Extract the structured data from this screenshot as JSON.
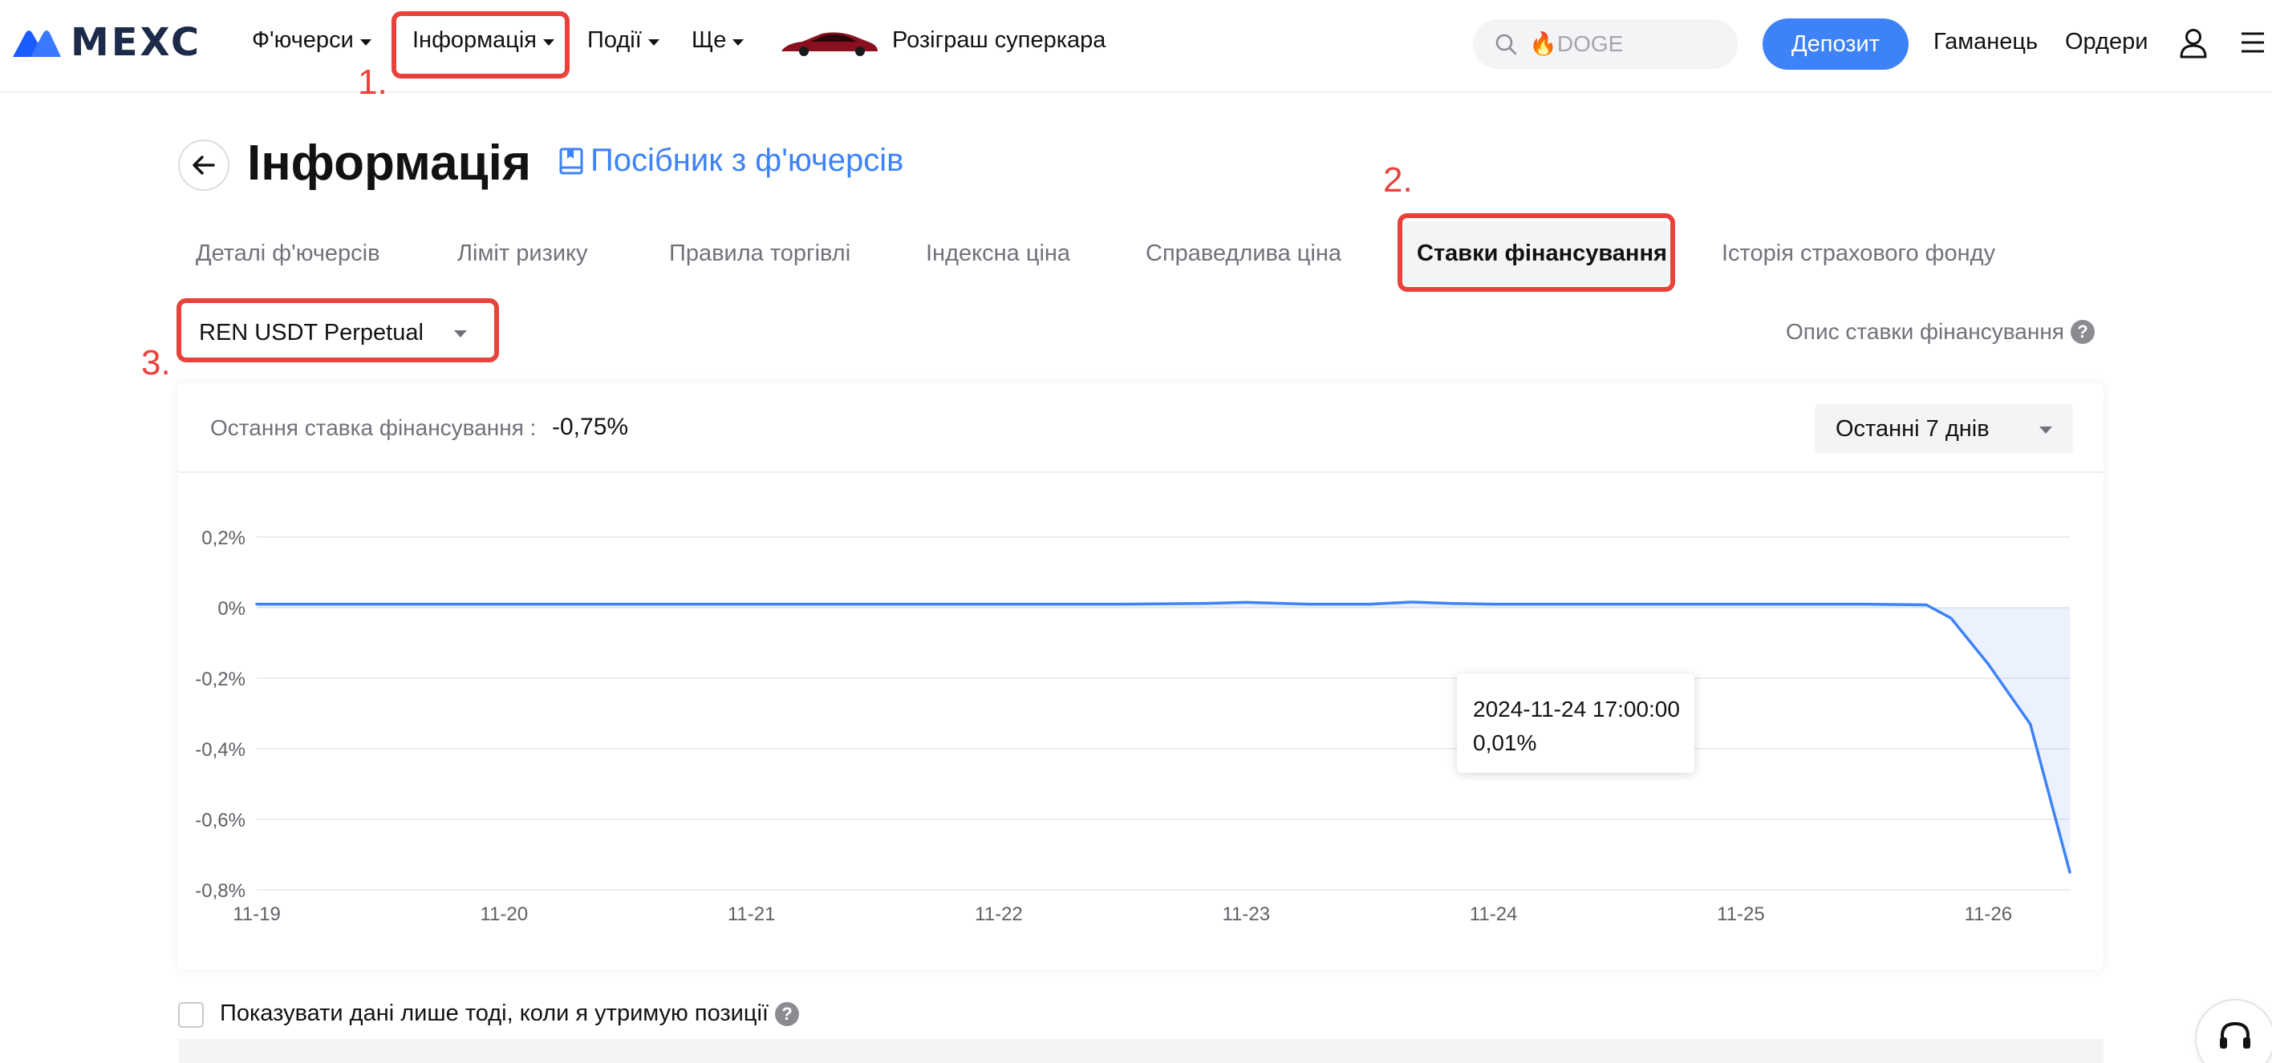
{
  "nav": {
    "logo_text": "MEXC",
    "items": [
      {
        "label": "Ф'ючерси"
      },
      {
        "label": "Інформація"
      },
      {
        "label": "Події"
      },
      {
        "label": "Ще"
      }
    ],
    "promo_label": "Розіграш суперкара",
    "search_placeholder": "🔥DOGE",
    "deposit_label": "Депозит",
    "wallet_label": "Гаманець",
    "orders_label": "Ордери"
  },
  "annotations": [
    "1.",
    "2.",
    "3."
  ],
  "page": {
    "title": "Інформація",
    "guide_link": "Посібник з ф'ючерсів"
  },
  "tabs": [
    {
      "label": "Деталі ф'ючерсів",
      "active": false
    },
    {
      "label": "Ліміт ризику",
      "active": false
    },
    {
      "label": "Правила торгівлі",
      "active": false
    },
    {
      "label": "Індексна ціна",
      "active": false
    },
    {
      "label": "Справедлива ціна",
      "active": false
    },
    {
      "label": "Ставки фінансування",
      "active": true
    },
    {
      "label": "Історія страхового фонду",
      "active": false
    }
  ],
  "contract_select": {
    "value": "REN USDT Perpetual"
  },
  "funding_description_label": "Опис ставки фінансування",
  "card": {
    "last_rate_label": "Остання ставка фінансування :",
    "last_rate_value": "-0,75%",
    "period_value": "Останні 7 днів"
  },
  "tooltip": {
    "time": "2024-11-24 17:00:00",
    "value": "0,01%"
  },
  "bottom": {
    "checkbox_label": "Показувати дані лише тоді, коли я утримую позиції"
  },
  "colors": {
    "accent": "#3e82f7",
    "annotation": "#e8423b",
    "text_primary": "#121212",
    "text_secondary": "#71717a"
  },
  "chart_data": {
    "type": "area",
    "title": "",
    "xlabel": "",
    "ylabel": "",
    "x_ticks": [
      "11-19",
      "11-20",
      "11-21",
      "11-22",
      "11-23",
      "11-24",
      "11-25",
      "11-26"
    ],
    "y_ticks": [
      "0,2%",
      "0%",
      "-0,2%",
      "-0,4%",
      "-0,6%",
      "-0,8%"
    ],
    "ylim": [
      -0.8,
      0.2
    ],
    "xlim": [
      0,
      7.33
    ],
    "grid": true,
    "series": [
      {
        "values": [
          {
            "x": 0,
            "y": 0.01
          },
          {
            "x": 0.5,
            "y": 0.01
          },
          {
            "x": 1,
            "y": 0.01
          },
          {
            "x": 1.5,
            "y": 0.01
          },
          {
            "x": 2,
            "y": 0.01
          },
          {
            "x": 2.5,
            "y": 0.01
          },
          {
            "x": 3,
            "y": 0.01
          },
          {
            "x": 3.5,
            "y": 0.01
          },
          {
            "x": 3.83,
            "y": 0.012
          },
          {
            "x": 4,
            "y": 0.015
          },
          {
            "x": 4.25,
            "y": 0.01
          },
          {
            "x": 4.5,
            "y": 0.01
          },
          {
            "x": 4.67,
            "y": 0.016
          },
          {
            "x": 4.83,
            "y": 0.012
          },
          {
            "x": 5,
            "y": 0.01
          },
          {
            "x": 5.5,
            "y": 0.01
          },
          {
            "x": 6,
            "y": 0.01
          },
          {
            "x": 6.5,
            "y": 0.01
          },
          {
            "x": 6.75,
            "y": 0.008
          },
          {
            "x": 6.85,
            "y": -0.03
          },
          {
            "x": 7.0,
            "y": -0.16
          },
          {
            "x": 7.17,
            "y": -0.33
          },
          {
            "x": 7.33,
            "y": -0.75
          }
        ]
      }
    ]
  }
}
